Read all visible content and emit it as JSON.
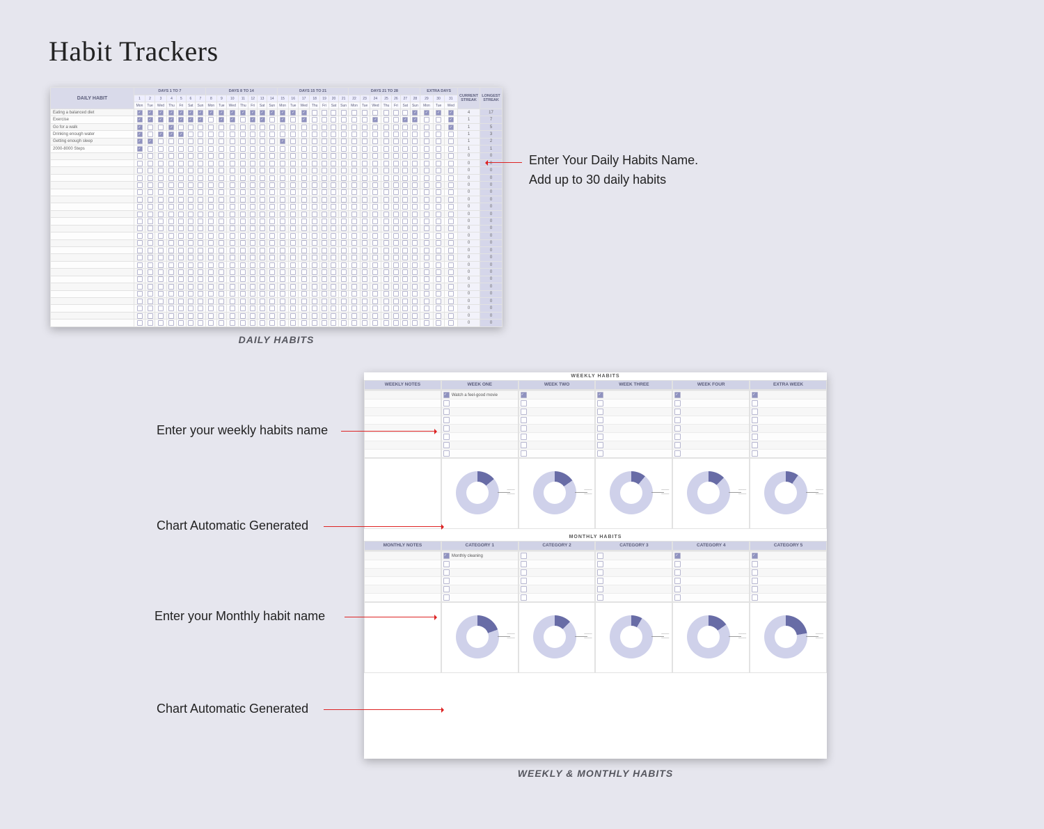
{
  "title": "Habit Trackers",
  "daily": {
    "caption": "DAILY HABITS",
    "habit_header": "DAILY HABIT",
    "current_streak_header": "CURRENT STREAK",
    "longest_streak_header": "LONGEST STREAK",
    "groups": [
      "DAYS 1 TO 7",
      "DAYS 8 TO 14",
      "DAYS 15 TO 21",
      "DAYS 21 TO 28",
      "EXTRA DAYS"
    ],
    "day_numbers": [
      1,
      2,
      3,
      4,
      5,
      6,
      7,
      8,
      9,
      10,
      11,
      12,
      13,
      14,
      15,
      16,
      17,
      18,
      19,
      20,
      21,
      22,
      23,
      24,
      25,
      26,
      27,
      28,
      29,
      30,
      31
    ],
    "dows": [
      "Mon",
      "Tue",
      "Wed",
      "Thu",
      "Fri",
      "Sat",
      "Sun",
      "Mon",
      "Tue",
      "Wed",
      "Thu",
      "Fri",
      "Sat",
      "Sun",
      "Mon",
      "Tue",
      "Wed",
      "Thu",
      "Fri",
      "Sat",
      "Sun",
      "Mon",
      "Tue",
      "Wed",
      "Thu",
      "Fri",
      "Sat",
      "Sun",
      "Mon",
      "Tue",
      "Wed"
    ],
    "habits": [
      {
        "name": "Eating a balanced diet",
        "current": 4,
        "longest": 17,
        "checks": [
          1,
          1,
          1,
          1,
          1,
          1,
          1,
          1,
          1,
          1,
          1,
          1,
          1,
          1,
          1,
          1,
          1,
          0,
          0,
          0,
          0,
          0,
          0,
          0,
          0,
          0,
          0,
          1,
          1,
          1,
          1
        ]
      },
      {
        "name": "Exercise",
        "current": 1,
        "longest": 7,
        "checks": [
          1,
          1,
          1,
          1,
          1,
          1,
          1,
          0,
          1,
          1,
          0,
          1,
          1,
          0,
          1,
          0,
          1,
          0,
          0,
          0,
          0,
          0,
          0,
          1,
          0,
          0,
          1,
          1,
          0,
          0,
          1
        ]
      },
      {
        "name": "Go for a walk",
        "current": 1,
        "longest": 5,
        "checks": [
          1,
          0,
          0,
          1,
          0,
          0,
          0,
          0,
          0,
          0,
          0,
          0,
          0,
          0,
          0,
          0,
          0,
          0,
          0,
          0,
          0,
          0,
          0,
          0,
          0,
          0,
          0,
          0,
          0,
          0,
          1
        ]
      },
      {
        "name": "Drinking enough water",
        "current": 1,
        "longest": 3,
        "checks": [
          1,
          0,
          1,
          1,
          1,
          0,
          0,
          0,
          0,
          0,
          0,
          0,
          0,
          0,
          0,
          0,
          0,
          0,
          0,
          0,
          0,
          0,
          0,
          0,
          0,
          0,
          0,
          0,
          0,
          0,
          0
        ]
      },
      {
        "name": "Getting enough sleep",
        "current": 1,
        "longest": 2,
        "checks": [
          1,
          1,
          0,
          0,
          0,
          0,
          0,
          0,
          0,
          0,
          0,
          0,
          0,
          0,
          1,
          0,
          0,
          0,
          0,
          0,
          0,
          0,
          0,
          0,
          0,
          0,
          0,
          0,
          0,
          0,
          0
        ]
      },
      {
        "name": "2000-8000 Steps",
        "current": 1,
        "longest": 1,
        "checks": [
          1,
          0,
          0,
          0,
          0,
          0,
          0,
          0,
          0,
          0,
          0,
          0,
          0,
          0,
          0,
          0,
          0,
          0,
          0,
          0,
          0,
          0,
          0,
          0,
          0,
          0,
          0,
          0,
          0,
          0,
          0
        ]
      }
    ],
    "empty_rows": 24
  },
  "daily_callouts": {
    "line1": "Enter Your Daily Habits Name.",
    "line2": "Add up to 30 daily habits"
  },
  "weekly": {
    "title": "WEEKLY HABITS",
    "heads": [
      "WEEKLY NOTES",
      "WEEK ONE",
      "WEEK TWO",
      "WEEK THREE",
      "WEEK FOUR",
      "EXTRA WEEK"
    ],
    "example_habit": "Watch a feel-good movie",
    "row_count": 8,
    "donuts_deg": [
      50,
      55,
      40,
      45,
      35
    ]
  },
  "monthly": {
    "title": "MONTHLY HABITS",
    "heads": [
      "MONTHLY NOTES",
      "CATEGORY 1",
      "CATEGORY 2",
      "CATEGORY 3",
      "CATEGORY 4",
      "CATEGORY 5"
    ],
    "example_habit": "Monthly cleaning",
    "row_count": 6,
    "donuts_deg": [
      70,
      45,
      30,
      55,
      80
    ]
  },
  "wm_caption": "WEEKLY & MONTHLY HABITS",
  "left_callouts": {
    "weekly_name": "Enter your weekly habits name",
    "weekly_chart": "Chart Automatic Generated",
    "monthly_name": "Enter your Monthly habit name",
    "monthly_chart": "Chart Automatic Generated"
  }
}
